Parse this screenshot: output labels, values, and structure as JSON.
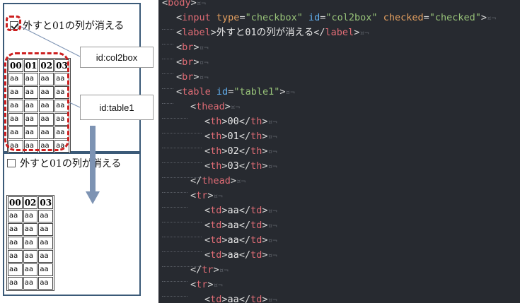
{
  "preview": {
    "checked_state": {
      "checkbox_checked": true,
      "label": "外すと01の列が消える",
      "headers": [
        "00",
        "01",
        "02",
        "03"
      ],
      "rows": [
        [
          "aa",
          "aa",
          "aa",
          "aa"
        ],
        [
          "aa",
          "aa",
          "aa",
          "aa"
        ],
        [
          "aa",
          "aa",
          "aa",
          "aa"
        ],
        [
          "aa",
          "aa",
          "aa",
          "aa"
        ],
        [
          "aa",
          "aa",
          "aa",
          "aa"
        ],
        [
          "aa",
          "aa",
          "aa",
          "aa"
        ]
      ]
    },
    "unchecked_state": {
      "checkbox_checked": false,
      "label": "外すと01の列が消える",
      "headers": [
        "00",
        "02",
        "03"
      ],
      "rows": [
        [
          "aa",
          "aa",
          "aa"
        ],
        [
          "aa",
          "aa",
          "aa"
        ],
        [
          "aa",
          "aa",
          "aa"
        ],
        [
          "aa",
          "aa",
          "aa"
        ],
        [
          "aa",
          "aa",
          "aa"
        ],
        [
          "aa",
          "aa",
          "aa"
        ]
      ]
    },
    "annotations": {
      "checkbox_id_label": "id:col2box",
      "table_id_label": "id:table1"
    },
    "colors": {
      "panel_border": "#3b5a78",
      "annotation_red": "#cc1f1f",
      "arrow": "#7d93b3"
    }
  },
  "editor": {
    "background": "#272a30",
    "eol_marker": "¤¬",
    "lines": [
      {
        "indent": 0,
        "tokens": [
          [
            "punc",
            "<"
          ],
          [
            "tag",
            "body"
          ],
          [
            "punc",
            ">"
          ]
        ]
      },
      {
        "indent": 1,
        "tokens": [
          [
            "punc",
            "<"
          ],
          [
            "tag",
            "input"
          ],
          [
            "punc",
            " "
          ],
          [
            "attr",
            "type"
          ],
          [
            "punc",
            "="
          ],
          [
            "val",
            "\"checkbox\""
          ],
          [
            "punc",
            " "
          ],
          [
            "idattr",
            "id"
          ],
          [
            "punc",
            "="
          ],
          [
            "val",
            "\"col2box\""
          ],
          [
            "punc",
            " "
          ],
          [
            "attr",
            "checked"
          ],
          [
            "punc",
            "="
          ],
          [
            "val",
            "\"checked\""
          ],
          [
            "punc",
            ">"
          ]
        ]
      },
      {
        "indent": 1,
        "tokens": [
          [
            "punc",
            "<"
          ],
          [
            "tag",
            "label"
          ],
          [
            "punc",
            ">"
          ],
          [
            "text",
            "外すと01の列が消える"
          ],
          [
            "punc",
            "</"
          ],
          [
            "tag",
            "label"
          ],
          [
            "punc",
            ">"
          ]
        ]
      },
      {
        "indent": 1,
        "tokens": [
          [
            "punc",
            "<"
          ],
          [
            "tag",
            "br"
          ],
          [
            "punc",
            ">"
          ]
        ]
      },
      {
        "indent": 1,
        "tokens": [
          [
            "punc",
            "<"
          ],
          [
            "tag",
            "br"
          ],
          [
            "punc",
            ">"
          ]
        ]
      },
      {
        "indent": 1,
        "tokens": [
          [
            "punc",
            "<"
          ],
          [
            "tag",
            "br"
          ],
          [
            "punc",
            ">"
          ]
        ]
      },
      {
        "indent": 1,
        "tokens": [
          [
            "punc",
            "<"
          ],
          [
            "tag",
            "table"
          ],
          [
            "punc",
            " "
          ],
          [
            "idattr",
            "id"
          ],
          [
            "punc",
            "="
          ],
          [
            "val",
            "\"table1\""
          ],
          [
            "punc",
            ">"
          ]
        ]
      },
      {
        "indent": 2,
        "tokens": [
          [
            "punc",
            "<"
          ],
          [
            "tag",
            "thead"
          ],
          [
            "punc",
            ">"
          ]
        ]
      },
      {
        "indent": 3,
        "tokens": [
          [
            "punc",
            "<"
          ],
          [
            "tag",
            "th"
          ],
          [
            "punc",
            ">"
          ],
          [
            "text",
            "00"
          ],
          [
            "punc",
            "</"
          ],
          [
            "tag",
            "th"
          ],
          [
            "punc",
            ">"
          ]
        ]
      },
      {
        "indent": 3,
        "tokens": [
          [
            "punc",
            "<"
          ],
          [
            "tag",
            "th"
          ],
          [
            "punc",
            ">"
          ],
          [
            "text",
            "01"
          ],
          [
            "punc",
            "</"
          ],
          [
            "tag",
            "th"
          ],
          [
            "punc",
            ">"
          ]
        ]
      },
      {
        "indent": 3,
        "tokens": [
          [
            "punc",
            "<"
          ],
          [
            "tag",
            "th"
          ],
          [
            "punc",
            ">"
          ],
          [
            "text",
            "02"
          ],
          [
            "punc",
            "</"
          ],
          [
            "tag",
            "th"
          ],
          [
            "punc",
            ">"
          ]
        ]
      },
      {
        "indent": 3,
        "tokens": [
          [
            "punc",
            "<"
          ],
          [
            "tag",
            "th"
          ],
          [
            "punc",
            ">"
          ],
          [
            "text",
            "03"
          ],
          [
            "punc",
            "</"
          ],
          [
            "tag",
            "th"
          ],
          [
            "punc",
            ">"
          ]
        ]
      },
      {
        "indent": 2,
        "tokens": [
          [
            "punc",
            "</"
          ],
          [
            "tag",
            "thead"
          ],
          [
            "punc",
            ">"
          ]
        ]
      },
      {
        "indent": 2,
        "tokens": [
          [
            "punc",
            "<"
          ],
          [
            "tag",
            "tr"
          ],
          [
            "punc",
            ">"
          ]
        ]
      },
      {
        "indent": 3,
        "tokens": [
          [
            "punc",
            "<"
          ],
          [
            "tag",
            "td"
          ],
          [
            "punc",
            ">"
          ],
          [
            "text",
            "aa"
          ],
          [
            "punc",
            "</"
          ],
          [
            "tag",
            "td"
          ],
          [
            "punc",
            ">"
          ]
        ]
      },
      {
        "indent": 3,
        "tokens": [
          [
            "punc",
            "<"
          ],
          [
            "tag",
            "td"
          ],
          [
            "punc",
            ">"
          ],
          [
            "text",
            "aa"
          ],
          [
            "punc",
            "</"
          ],
          [
            "tag",
            "td"
          ],
          [
            "punc",
            ">"
          ]
        ]
      },
      {
        "indent": 3,
        "tokens": [
          [
            "punc",
            "<"
          ],
          [
            "tag",
            "td"
          ],
          [
            "punc",
            ">"
          ],
          [
            "text",
            "aa"
          ],
          [
            "punc",
            "</"
          ],
          [
            "tag",
            "td"
          ],
          [
            "punc",
            ">"
          ]
        ]
      },
      {
        "indent": 3,
        "tokens": [
          [
            "punc",
            "<"
          ],
          [
            "tag",
            "td"
          ],
          [
            "punc",
            ">"
          ],
          [
            "text",
            "aa"
          ],
          [
            "punc",
            "</"
          ],
          [
            "tag",
            "td"
          ],
          [
            "punc",
            ">"
          ]
        ]
      },
      {
        "indent": 2,
        "tokens": [
          [
            "punc",
            "</"
          ],
          [
            "tag",
            "tr"
          ],
          [
            "punc",
            ">"
          ]
        ]
      },
      {
        "indent": 2,
        "tokens": [
          [
            "punc",
            "<"
          ],
          [
            "tag",
            "tr"
          ],
          [
            "punc",
            ">"
          ]
        ]
      },
      {
        "indent": 3,
        "tokens": [
          [
            "punc",
            "<"
          ],
          [
            "tag",
            "td"
          ],
          [
            "punc",
            ">"
          ],
          [
            "text",
            "aa"
          ],
          [
            "punc",
            "</"
          ],
          [
            "tag",
            "td"
          ],
          [
            "punc",
            ">"
          ]
        ]
      }
    ]
  }
}
